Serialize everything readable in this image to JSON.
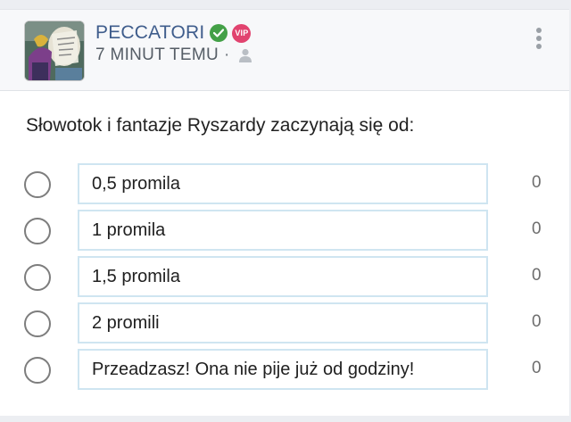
{
  "post": {
    "author": "PECCATORI",
    "badges": {
      "verified": "check-circle-icon",
      "vip": "VIP"
    },
    "time": "7 MINUT TEMU",
    "separator": "·",
    "visibility_icon": "person-icon",
    "menu_icon": "more-vertical-icon"
  },
  "poll": {
    "question": "Słowotok i fantazje Ryszardy zaczynają się od:",
    "options": [
      {
        "label": "0,5 promila",
        "count": "0"
      },
      {
        "label": "1 promila",
        "count": "0"
      },
      {
        "label": "1,5 promila",
        "count": "0"
      },
      {
        "label": "2 promili",
        "count": "0"
      },
      {
        "label": "Przeadzasz! Ona nie pije już od godziny!",
        "count": "0"
      }
    ]
  },
  "colors": {
    "author": "#3f5d8c",
    "verified": "#43a047",
    "vip": "#e1436f",
    "option_border": "#cfe5f1"
  }
}
